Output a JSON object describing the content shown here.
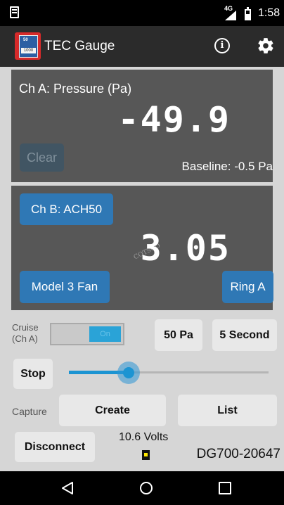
{
  "status_bar": {
    "network": "4G",
    "time": "1:58"
  },
  "app_bar": {
    "title": "TEC Gauge",
    "logo": {
      "top_text": "50",
      "value_text": "1000"
    },
    "info_icon": "i"
  },
  "channel_a": {
    "title": "Ch A: Pressure (Pa)",
    "value": "-49.9",
    "clear_label": "Clear",
    "baseline": "Baseline: -0.5 Pa"
  },
  "channel_b": {
    "button_label": "Ch B: ACH50",
    "value": "3.05",
    "model_label": "Model 3 Fan",
    "ring_label": "Ring A",
    "watermark": "COTSCO"
  },
  "controls": {
    "cruise_line1": "Cruise",
    "cruise_line2": "(Ch A)",
    "toggle_text": "On",
    "target_label": "50 Pa",
    "period_label": "5 Second",
    "stop_label": "Stop",
    "slider_level_fraction": 0.3,
    "capture_label": "Capture",
    "create_label": "Create",
    "list_label": "List",
    "disconnect_label": "Disconnect",
    "voltage": "10.6 Volts",
    "device_id": "DG700-20647"
  },
  "colors": {
    "accent_blue": "#2f78b5",
    "panel_gray": "#575757",
    "slider_blue": "#1c94d2",
    "battery_yellow": "#ffe800"
  }
}
